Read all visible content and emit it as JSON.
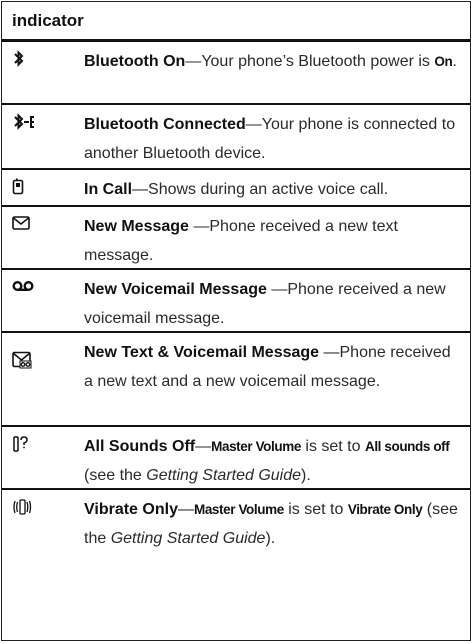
{
  "header": {
    "title": "indicator"
  },
  "rows": [
    {
      "icon": "bluetooth-icon",
      "title": "Bluetooth On",
      "text_a": "—Your phone’s Bluetooth power is ",
      "cond_a": "On",
      "text_b": "."
    },
    {
      "icon": "bluetooth-connected-icon",
      "title": "Bluetooth Connected",
      "text_a": "—Your phone is connected to another Bluetooth device."
    },
    {
      "icon": "in-call-icon",
      "title": "In Call",
      "text_a": "—Shows during an active voice call."
    },
    {
      "icon": "envelope-icon",
      "title": "New Message",
      "text_a": " —Phone received a new text message."
    },
    {
      "icon": "voicemail-icon",
      "title": "New Voicemail Message",
      "text_a": " —Phone received a new voicemail message."
    },
    {
      "icon": "text-voicemail-icon",
      "title": "New Text & Voicemail Message",
      "text_a": " —Phone received a new text and a new voicemail message."
    },
    {
      "icon": "sounds-off-icon",
      "title": "All Sounds Off",
      "text_a": "—",
      "cond_a": "Master Volume",
      "text_b": " is set to ",
      "cond_b": "All sounds off",
      "text_c": " (see the ",
      "italic": "Getting Started Guide",
      "text_d": ")."
    },
    {
      "icon": "vibrate-icon",
      "title": "Vibrate Only",
      "text_a": "—",
      "cond_a": "Master Volume",
      "text_b": " is set to ",
      "cond_b": "Vibrate Only",
      "text_c": " (see the ",
      "italic": "Getting Started Guide",
      "text_d": ")."
    }
  ]
}
